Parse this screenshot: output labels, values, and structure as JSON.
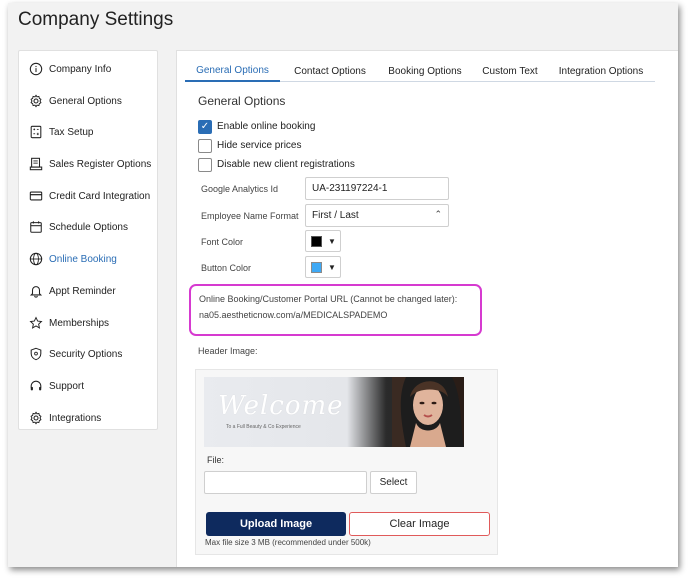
{
  "page": {
    "title": "Company Settings"
  },
  "sidebar": {
    "items": [
      {
        "label": "Company Info",
        "icon": "info-icon"
      },
      {
        "label": "General Options",
        "icon": "gear-icon"
      },
      {
        "label": "Tax Setup",
        "icon": "calculator-icon"
      },
      {
        "label": "Sales Register Options",
        "icon": "register-icon"
      },
      {
        "label": "Credit Card Integration",
        "icon": "credit-card-icon"
      },
      {
        "label": "Schedule Options",
        "icon": "calendar-icon"
      },
      {
        "label": "Online Booking",
        "icon": "globe-icon",
        "active": true
      },
      {
        "label": "Appt Reminder",
        "icon": "bell-icon"
      },
      {
        "label": "Memberships",
        "icon": "star-icon"
      },
      {
        "label": "Security Options",
        "icon": "shield-icon"
      },
      {
        "label": "Support",
        "icon": "headset-icon"
      },
      {
        "label": "Integrations",
        "icon": "gear-icon"
      }
    ]
  },
  "tabs": [
    {
      "label": "General Options",
      "active": true
    },
    {
      "label": "Contact Options"
    },
    {
      "label": "Booking Options"
    },
    {
      "label": "Custom Text"
    },
    {
      "label": "Integration Options"
    }
  ],
  "general": {
    "section_title": "General Options",
    "checkboxes": [
      {
        "label": "Enable online booking",
        "checked": true
      },
      {
        "label": "Hide service prices",
        "checked": false
      },
      {
        "label": "Disable new client registrations",
        "checked": false
      }
    ],
    "analytics_label": "Google Analytics Id",
    "analytics_value": "UA-231197224-1",
    "employee_format_label": "Employee Name Format",
    "employee_format_value": "First / Last",
    "font_color_label": "Font Color",
    "font_color": "#000000",
    "button_color_label": "Button Color",
    "button_color": "#3fa9f5"
  },
  "portal": {
    "label": "Online Booking/Customer Portal URL (Cannot be changed later):",
    "url": "na05.aestheticnow.com/a/MEDICALSPADEMO",
    "highlight_color": "#d63ad0"
  },
  "header_image": {
    "label": "Header Image:",
    "banner_title": "Welcome",
    "banner_subtitle": "To a Full Beauty & Co Experience",
    "file_label": "File:",
    "file_value": "",
    "select_label": "Select",
    "upload_label": "Upload Image",
    "clear_label": "Clear Image",
    "max_size": "Max file size 3 MB (recommended under 500k)"
  },
  "colors": {
    "accent": "#2a6db5",
    "upload_button": "#0e2a5e",
    "clear_border": "#e05a5a"
  }
}
